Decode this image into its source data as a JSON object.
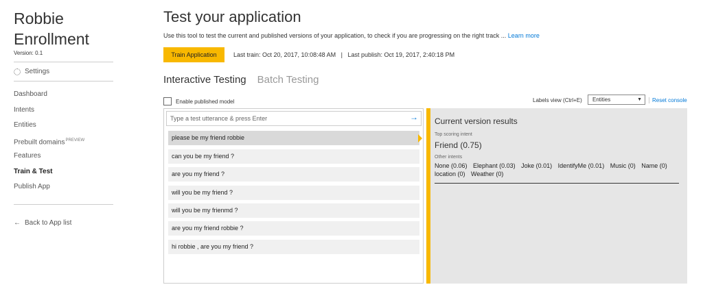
{
  "sidebar": {
    "app_name_line1": "Robbie",
    "app_name_line2": "Enrollment",
    "version": "Version:  0.1",
    "settings_label": "Settings",
    "nav": [
      {
        "label": "Dashboard"
      },
      {
        "label": "Intents"
      },
      {
        "label": "Entities"
      },
      {
        "label": "Prebuilt domains",
        "badge": "PREVIEW"
      },
      {
        "label": "Features"
      },
      {
        "label": "Train & Test",
        "active": true
      },
      {
        "label": "Publish App"
      }
    ],
    "back_label": "Back to App list"
  },
  "main": {
    "title": "Test your application",
    "description": "Use this tool to test the current and published versions of your application, to check if you are progressing on the right track ...",
    "learn_more": "Learn more",
    "train_button": "Train Application",
    "last_train": "Last train: Oct 20, 2017, 10:08:48 AM",
    "separator": "|",
    "last_publish": "Last publish: Oct 19, 2017, 2:40:18 PM",
    "tabs": [
      {
        "label": "Interactive Testing",
        "active": true
      },
      {
        "label": "Batch Testing",
        "active": false
      }
    ],
    "enable_published_label": "Enable published model",
    "labels_view_label": "Labels view (Ctrl+E)",
    "labels_view_value": "Entities",
    "reset_console": "Reset console"
  },
  "test": {
    "input_placeholder": "Type a test utterance & press Enter",
    "utterances": [
      "please be my friend robbie",
      "can you be my friend ?",
      "are you my friend ?",
      "will you be my friend ?",
      "will you be my frienmd ?",
      "are you my friend robbie ?",
      "hi robbie , are you my friend ?"
    ]
  },
  "results": {
    "title": "Current version results",
    "top_label": "Top scoring intent",
    "top_intent": "Friend (0.75)",
    "other_label": "Other intents",
    "other_intents": [
      "None (0.06)",
      "Elephant (0.03)",
      "Joke (0.01)",
      "IdentifyMe (0.01)",
      "Music (0)",
      "Name (0)",
      "location (0)",
      "Weather (0)"
    ]
  },
  "colors": {
    "accent": "#f8b800",
    "link": "#0078d7",
    "results_bg": "#e6e6e6"
  }
}
